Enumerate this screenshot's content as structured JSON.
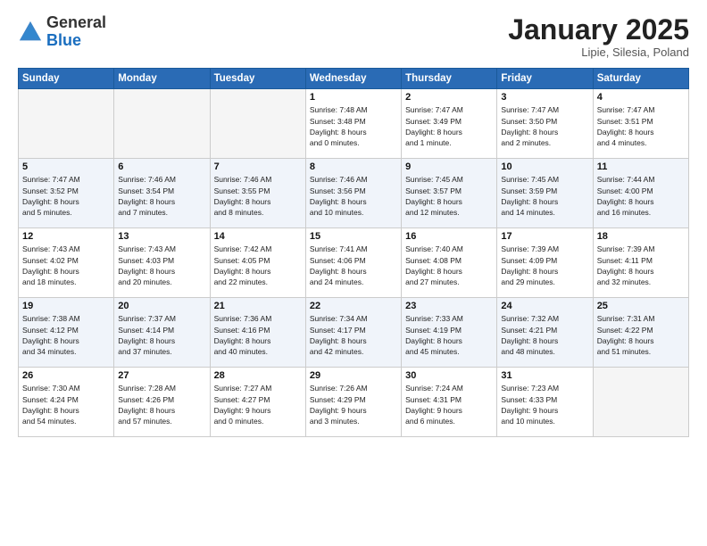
{
  "header": {
    "logo_general": "General",
    "logo_blue": "Blue",
    "month_title": "January 2025",
    "location": "Lipie, Silesia, Poland"
  },
  "days_of_week": [
    "Sunday",
    "Monday",
    "Tuesday",
    "Wednesday",
    "Thursday",
    "Friday",
    "Saturday"
  ],
  "weeks": [
    [
      {
        "day": "",
        "info": ""
      },
      {
        "day": "",
        "info": ""
      },
      {
        "day": "",
        "info": ""
      },
      {
        "day": "1",
        "info": "Sunrise: 7:48 AM\nSunset: 3:48 PM\nDaylight: 8 hours\nand 0 minutes."
      },
      {
        "day": "2",
        "info": "Sunrise: 7:47 AM\nSunset: 3:49 PM\nDaylight: 8 hours\nand 1 minute."
      },
      {
        "day": "3",
        "info": "Sunrise: 7:47 AM\nSunset: 3:50 PM\nDaylight: 8 hours\nand 2 minutes."
      },
      {
        "day": "4",
        "info": "Sunrise: 7:47 AM\nSunset: 3:51 PM\nDaylight: 8 hours\nand 4 minutes."
      }
    ],
    [
      {
        "day": "5",
        "info": "Sunrise: 7:47 AM\nSunset: 3:52 PM\nDaylight: 8 hours\nand 5 minutes."
      },
      {
        "day": "6",
        "info": "Sunrise: 7:46 AM\nSunset: 3:54 PM\nDaylight: 8 hours\nand 7 minutes."
      },
      {
        "day": "7",
        "info": "Sunrise: 7:46 AM\nSunset: 3:55 PM\nDaylight: 8 hours\nand 8 minutes."
      },
      {
        "day": "8",
        "info": "Sunrise: 7:46 AM\nSunset: 3:56 PM\nDaylight: 8 hours\nand 10 minutes."
      },
      {
        "day": "9",
        "info": "Sunrise: 7:45 AM\nSunset: 3:57 PM\nDaylight: 8 hours\nand 12 minutes."
      },
      {
        "day": "10",
        "info": "Sunrise: 7:45 AM\nSunset: 3:59 PM\nDaylight: 8 hours\nand 14 minutes."
      },
      {
        "day": "11",
        "info": "Sunrise: 7:44 AM\nSunset: 4:00 PM\nDaylight: 8 hours\nand 16 minutes."
      }
    ],
    [
      {
        "day": "12",
        "info": "Sunrise: 7:43 AM\nSunset: 4:02 PM\nDaylight: 8 hours\nand 18 minutes."
      },
      {
        "day": "13",
        "info": "Sunrise: 7:43 AM\nSunset: 4:03 PM\nDaylight: 8 hours\nand 20 minutes."
      },
      {
        "day": "14",
        "info": "Sunrise: 7:42 AM\nSunset: 4:05 PM\nDaylight: 8 hours\nand 22 minutes."
      },
      {
        "day": "15",
        "info": "Sunrise: 7:41 AM\nSunset: 4:06 PM\nDaylight: 8 hours\nand 24 minutes."
      },
      {
        "day": "16",
        "info": "Sunrise: 7:40 AM\nSunset: 4:08 PM\nDaylight: 8 hours\nand 27 minutes."
      },
      {
        "day": "17",
        "info": "Sunrise: 7:39 AM\nSunset: 4:09 PM\nDaylight: 8 hours\nand 29 minutes."
      },
      {
        "day": "18",
        "info": "Sunrise: 7:39 AM\nSunset: 4:11 PM\nDaylight: 8 hours\nand 32 minutes."
      }
    ],
    [
      {
        "day": "19",
        "info": "Sunrise: 7:38 AM\nSunset: 4:12 PM\nDaylight: 8 hours\nand 34 minutes."
      },
      {
        "day": "20",
        "info": "Sunrise: 7:37 AM\nSunset: 4:14 PM\nDaylight: 8 hours\nand 37 minutes."
      },
      {
        "day": "21",
        "info": "Sunrise: 7:36 AM\nSunset: 4:16 PM\nDaylight: 8 hours\nand 40 minutes."
      },
      {
        "day": "22",
        "info": "Sunrise: 7:34 AM\nSunset: 4:17 PM\nDaylight: 8 hours\nand 42 minutes."
      },
      {
        "day": "23",
        "info": "Sunrise: 7:33 AM\nSunset: 4:19 PM\nDaylight: 8 hours\nand 45 minutes."
      },
      {
        "day": "24",
        "info": "Sunrise: 7:32 AM\nSunset: 4:21 PM\nDaylight: 8 hours\nand 48 minutes."
      },
      {
        "day": "25",
        "info": "Sunrise: 7:31 AM\nSunset: 4:22 PM\nDaylight: 8 hours\nand 51 minutes."
      }
    ],
    [
      {
        "day": "26",
        "info": "Sunrise: 7:30 AM\nSunset: 4:24 PM\nDaylight: 8 hours\nand 54 minutes."
      },
      {
        "day": "27",
        "info": "Sunrise: 7:28 AM\nSunset: 4:26 PM\nDaylight: 8 hours\nand 57 minutes."
      },
      {
        "day": "28",
        "info": "Sunrise: 7:27 AM\nSunset: 4:27 PM\nDaylight: 9 hours\nand 0 minutes."
      },
      {
        "day": "29",
        "info": "Sunrise: 7:26 AM\nSunset: 4:29 PM\nDaylight: 9 hours\nand 3 minutes."
      },
      {
        "day": "30",
        "info": "Sunrise: 7:24 AM\nSunset: 4:31 PM\nDaylight: 9 hours\nand 6 minutes."
      },
      {
        "day": "31",
        "info": "Sunrise: 7:23 AM\nSunset: 4:33 PM\nDaylight: 9 hours\nand 10 minutes."
      },
      {
        "day": "",
        "info": ""
      }
    ]
  ]
}
